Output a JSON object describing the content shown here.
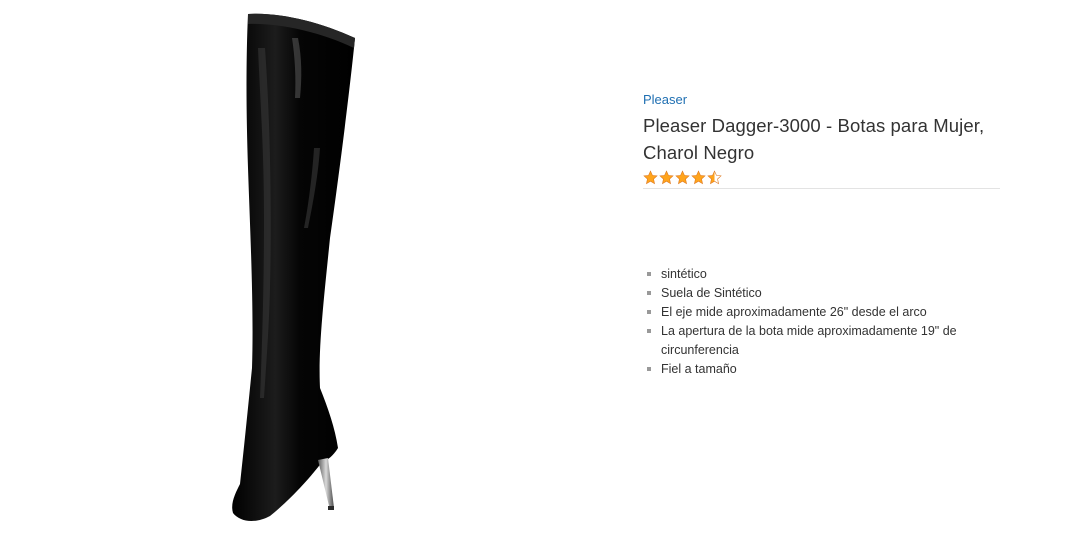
{
  "product": {
    "image_alt": "Pleaser Dagger-3000 boot",
    "brand": "Pleaser",
    "title": "Pleaser Dagger-3000 - Botas para Mujer, Charol Negro",
    "rating_stars": 4.5,
    "star_color": "#ffa41c",
    "features": [
      "sintético",
      "Suela de Sintético",
      "El eje mide aproximadamente 26\" desde el arco",
      "La apertura de la bota mide aproximadamente 19\" de circunferencia",
      "Fiel a tamaño"
    ]
  }
}
